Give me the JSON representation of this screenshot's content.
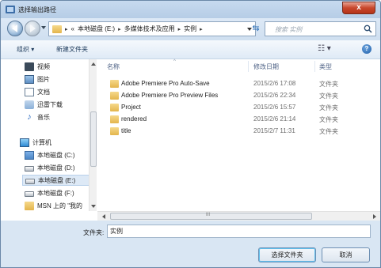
{
  "window": {
    "title": "选择输出路径",
    "close_label": "x"
  },
  "address": {
    "prefix": "«",
    "segments": [
      "本地磁盘 (E:)",
      "多媒体技术及应用",
      "实例"
    ]
  },
  "search": {
    "placeholder": "搜索 实例"
  },
  "toolbar": {
    "organize_label": "组织 ▾",
    "new_folder_label": "新建文件夹",
    "view_label": "☷ ▾",
    "help_label": "?"
  },
  "nav_pane": {
    "libraries": [
      {
        "label": "视频",
        "icon": "video-icon"
      },
      {
        "label": "图片",
        "icon": "picture-icon"
      },
      {
        "label": "文档",
        "icon": "document-icon"
      },
      {
        "label": "迅雷下载",
        "icon": "download-icon"
      },
      {
        "label": "音乐",
        "icon": "music-icon"
      }
    ],
    "computer": {
      "label": "计算机",
      "icon": "computer-icon"
    },
    "drives": [
      {
        "label": "本地磁盘 (C:)",
        "icon": "drive-icon",
        "selected": false
      },
      {
        "label": "本地磁盘 (D:)",
        "icon": "drive-icon",
        "selected": false
      },
      {
        "label": "本地磁盘 (E:)",
        "icon": "drive-icon",
        "selected": true
      },
      {
        "label": "本地磁盘 (F:)",
        "icon": "drive-icon",
        "selected": false
      }
    ],
    "msn": {
      "label": "MSN 上的 \"我的",
      "icon": "folder-icon"
    }
  },
  "columns": {
    "name": "名称",
    "modified": "修改日期",
    "type": "类型"
  },
  "files": [
    {
      "name": "Adobe Premiere Pro Auto-Save",
      "modified": "2015/2/6 17:08",
      "type": "文件夹"
    },
    {
      "name": "Adobe Premiere Pro Preview Files",
      "modified": "2015/2/6 22:34",
      "type": "文件夹"
    },
    {
      "name": "Project",
      "modified": "2015/2/6 15:57",
      "type": "文件夹"
    },
    {
      "name": "rendered",
      "modified": "2015/2/6 21:14",
      "type": "文件夹"
    },
    {
      "name": "title",
      "modified": "2015/2/7 11:31",
      "type": "文件夹"
    }
  ],
  "scroll_grip": "III",
  "folder_field": {
    "label": "文件夹:",
    "value": "实例"
  },
  "buttons": {
    "select_folder": "选择文件夹",
    "cancel": "取消"
  },
  "colors": {
    "selection_bg": "#dde9f6",
    "folder": "#e3b54c",
    "close": "#c8472c"
  }
}
